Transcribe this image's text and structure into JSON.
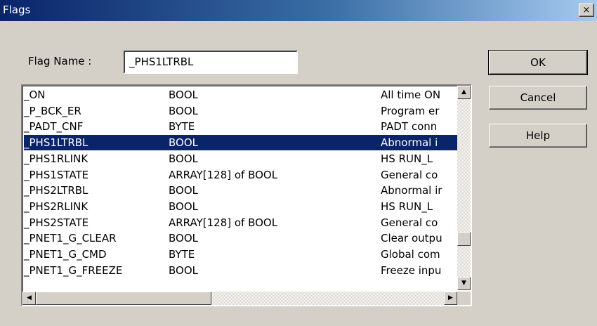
{
  "window": {
    "title": "Flags",
    "close_glyph": "×"
  },
  "flag_name": {
    "label": "Flag Name :",
    "value": "_PHS1LTRBL"
  },
  "buttons": {
    "ok": "OK",
    "cancel": "Cancel",
    "help": "Help"
  },
  "flags": [
    {
      "name": "_ON",
      "type": "BOOL",
      "desc": "All time ON"
    },
    {
      "name": "_P_BCK_ER",
      "type": "BOOL",
      "desc": "Program er"
    },
    {
      "name": "_PADT_CNF",
      "type": "BYTE",
      "desc": "PADT conn"
    },
    {
      "name": "_PHS1LTRBL",
      "type": "BOOL",
      "desc": "Abnormal i"
    },
    {
      "name": "_PHS1RLINK",
      "type": "BOOL",
      "desc": "HS RUN_L"
    },
    {
      "name": "_PHS1STATE",
      "type": "ARRAY[128] of BOOL",
      "desc": "General co"
    },
    {
      "name": "_PHS2LTRBL",
      "type": "BOOL",
      "desc": "Abnormal ir"
    },
    {
      "name": "_PHS2RLINK",
      "type": "BOOL",
      "desc": "HS RUN_L"
    },
    {
      "name": "_PHS2STATE",
      "type": "ARRAY[128] of BOOL",
      "desc": "General co"
    },
    {
      "name": "_PNET1_G_CLEAR",
      "type": "BOOL",
      "desc": "Clear outpu"
    },
    {
      "name": "_PNET1_G_CMD",
      "type": "BYTE",
      "desc": "Global com"
    },
    {
      "name": "_PNET1_G_FREEZE",
      "type": "BOOL",
      "desc": "Freeze inpu"
    }
  ],
  "selected_index": 3,
  "scroll": {
    "up": "▲",
    "down": "▼",
    "left": "◀",
    "right": "▶"
  },
  "colors": {
    "selection": "#0a246a",
    "face": "#d4d0c8"
  }
}
